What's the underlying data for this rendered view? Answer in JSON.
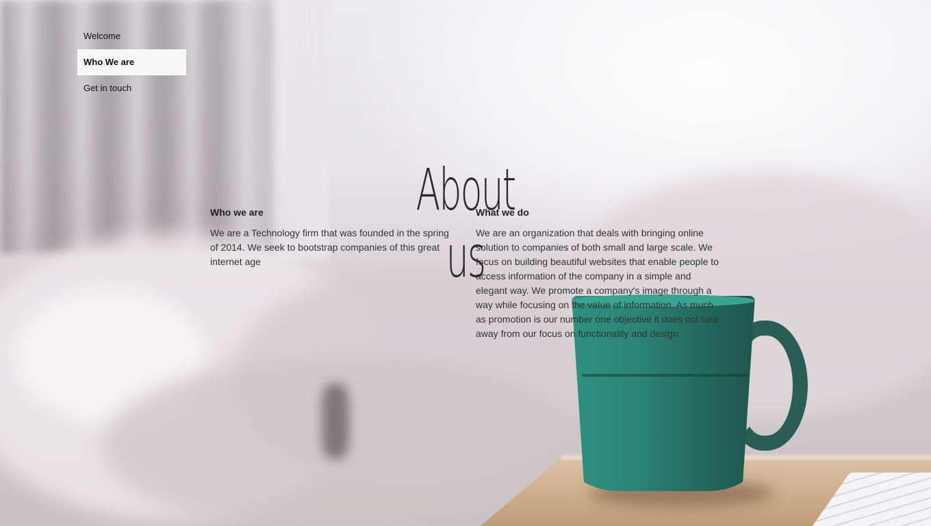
{
  "nav": {
    "items": [
      {
        "label": "Welcome",
        "active": false
      },
      {
        "label": "Who We are",
        "active": true
      },
      {
        "label": "Get in touch",
        "active": false
      }
    ]
  },
  "hero": {
    "title": "About us"
  },
  "sections": [
    {
      "heading": "Who we are",
      "body": "We are a Technology firm that was founded in the spring of 2014. We seek to bootstrap companies of this great internet age"
    },
    {
      "heading": "What we do",
      "body": "We are an organization that deals with bringing online solution to companies of both small and large scale. We focus on building beautiful websites that enable people to access information of the company in a simple and elegant way. We promote a company's image through a way while focusing on the value of information. As much as promotion is our number one objective it does not take away from our focus on functionality and design"
    }
  ],
  "colors": {
    "nav_active_bg": "#f7f7f7",
    "text": "#333333",
    "mug": "#2c8576"
  }
}
